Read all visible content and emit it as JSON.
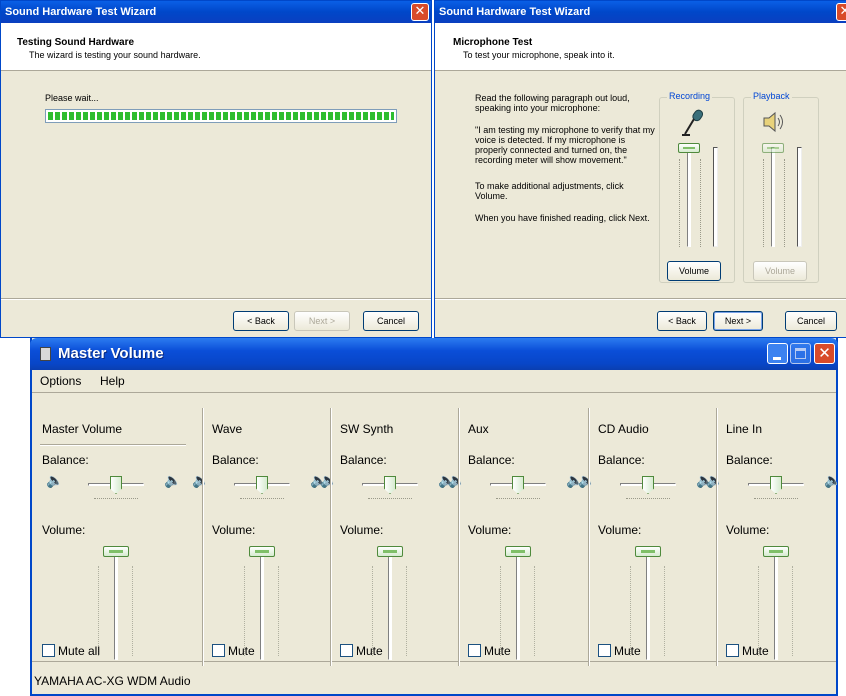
{
  "wizard1": {
    "title": "Sound Hardware Test Wizard",
    "header_title": "Testing Sound Hardware",
    "header_subtitle": "The wizard is testing your sound hardware.",
    "wait_text": "Please wait...",
    "progress": 1.0,
    "close_glyph": "✕",
    "back_label": "< Back",
    "next_label": "Next >",
    "cancel_label": "Cancel"
  },
  "wizard2": {
    "title": "Sound Hardware Test Wizard",
    "header_title": "Microphone Test",
    "header_subtitle": "To test your microphone, speak into it.",
    "para1_line1": "Read the following paragraph out loud,",
    "para1_line2": "speaking into your microphone:",
    "quote_line1": "\"I am testing my microphone to verify that my",
    "quote_line2": "voice is detected. If my microphone is",
    "quote_line3": "properly connected and turned on, the",
    "quote_line4": "recording meter will show movement.\"",
    "para3_line1": "To make additional adjustments, click",
    "para3_line2": "Volume.",
    "para4": "When you have finished reading, click Next.",
    "recording_label": "Recording",
    "playback_label": "Playback",
    "volume_label_rec": "Volume",
    "volume_label_play": "Volume",
    "back_label": "< Back",
    "next_label": "Next >",
    "cancel_label": "Cancel",
    "close_glyph": "✕"
  },
  "master": {
    "title": "Master Volume",
    "menu": [
      "Options",
      "Help"
    ],
    "status": "YAMAHA AC-XG WDM Audio",
    "balance_label": "Balance:",
    "volume_label": "Volume:",
    "channels": [
      {
        "name": "Master Volume",
        "mute": "Mute all"
      },
      {
        "name": "Wave",
        "mute": "Mute"
      },
      {
        "name": "SW Synth",
        "mute": "Mute"
      },
      {
        "name": "Aux",
        "mute": "Mute"
      },
      {
        "name": "CD Audio",
        "mute": "Mute"
      },
      {
        "name": "Line In",
        "mute": "Mute"
      }
    ],
    "colors": {
      "titlebar": "#0047c9",
      "close": "#d84b2a"
    }
  }
}
